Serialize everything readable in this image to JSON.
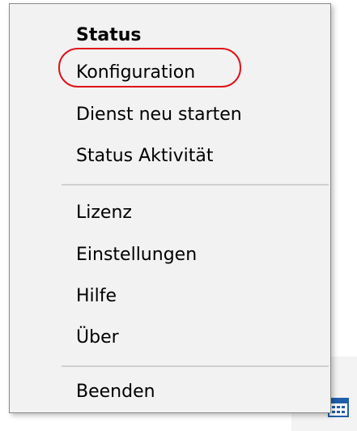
{
  "context_menu": {
    "items": [
      {
        "label": "Status",
        "bold": true
      },
      {
        "label": "Konfiguration",
        "highlighted": true
      },
      {
        "label": "Dienst neu starten"
      },
      {
        "label": "Status Aktivität"
      },
      {
        "label": "Lizenz"
      },
      {
        "label": "Einstellungen"
      },
      {
        "label": "Hilfe"
      },
      {
        "label": "Über"
      },
      {
        "label": "Beenden"
      }
    ]
  },
  "annotation": {
    "highlight_color": "#e0131a",
    "highlight_target": "Konfiguration"
  },
  "tray": {
    "icon": "calendar-app-icon",
    "icon_color": "#1f5fa8"
  }
}
